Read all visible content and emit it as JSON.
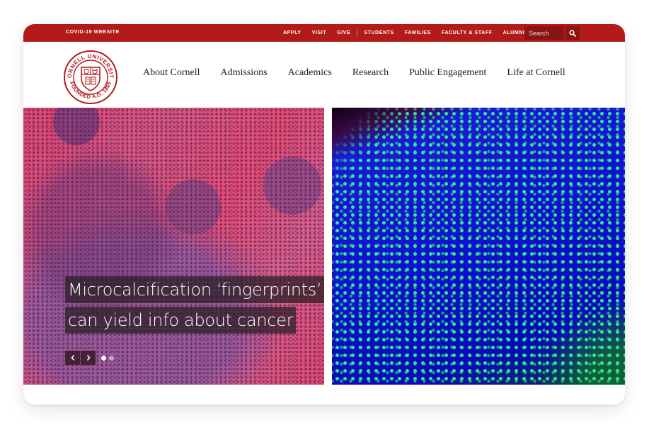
{
  "utility_bar": {
    "covid_link": "COVID-19 WEBSITE",
    "links": [
      "APPLY",
      "VISIT",
      "GIVE"
    ],
    "audience_links": [
      "STUDENTS",
      "FAMILIES",
      "FACULTY & STAFF",
      "ALUMNI"
    ],
    "search": {
      "placeholder": "Search",
      "value": "",
      "icon": "search-icon"
    },
    "color": "#b31b1b"
  },
  "header": {
    "logo": {
      "top_text": "CORNELL UNIVERSITY",
      "bottom_text": "FOUNDED A.D. 1865",
      "color": "#b31b1b"
    },
    "nav": [
      {
        "label": "About Cornell"
      },
      {
        "label": "Admissions"
      },
      {
        "label": "Academics"
      },
      {
        "label": "Research"
      },
      {
        "label": "Public Engagement"
      },
      {
        "label": "Life at Cornell"
      }
    ]
  },
  "hero": {
    "caption_lines": [
      "Microcalcification ‘fingerprints’",
      "can yield info about cancer"
    ],
    "left_image": "histology stained tissue (pink/purple)",
    "right_image": "fluorescence microscopy (blue/green)",
    "controls": {
      "prev_icon": "chevron-left-icon",
      "next_icon": "chevron-right-icon"
    },
    "slides_total": 2,
    "active_slide": 1
  }
}
